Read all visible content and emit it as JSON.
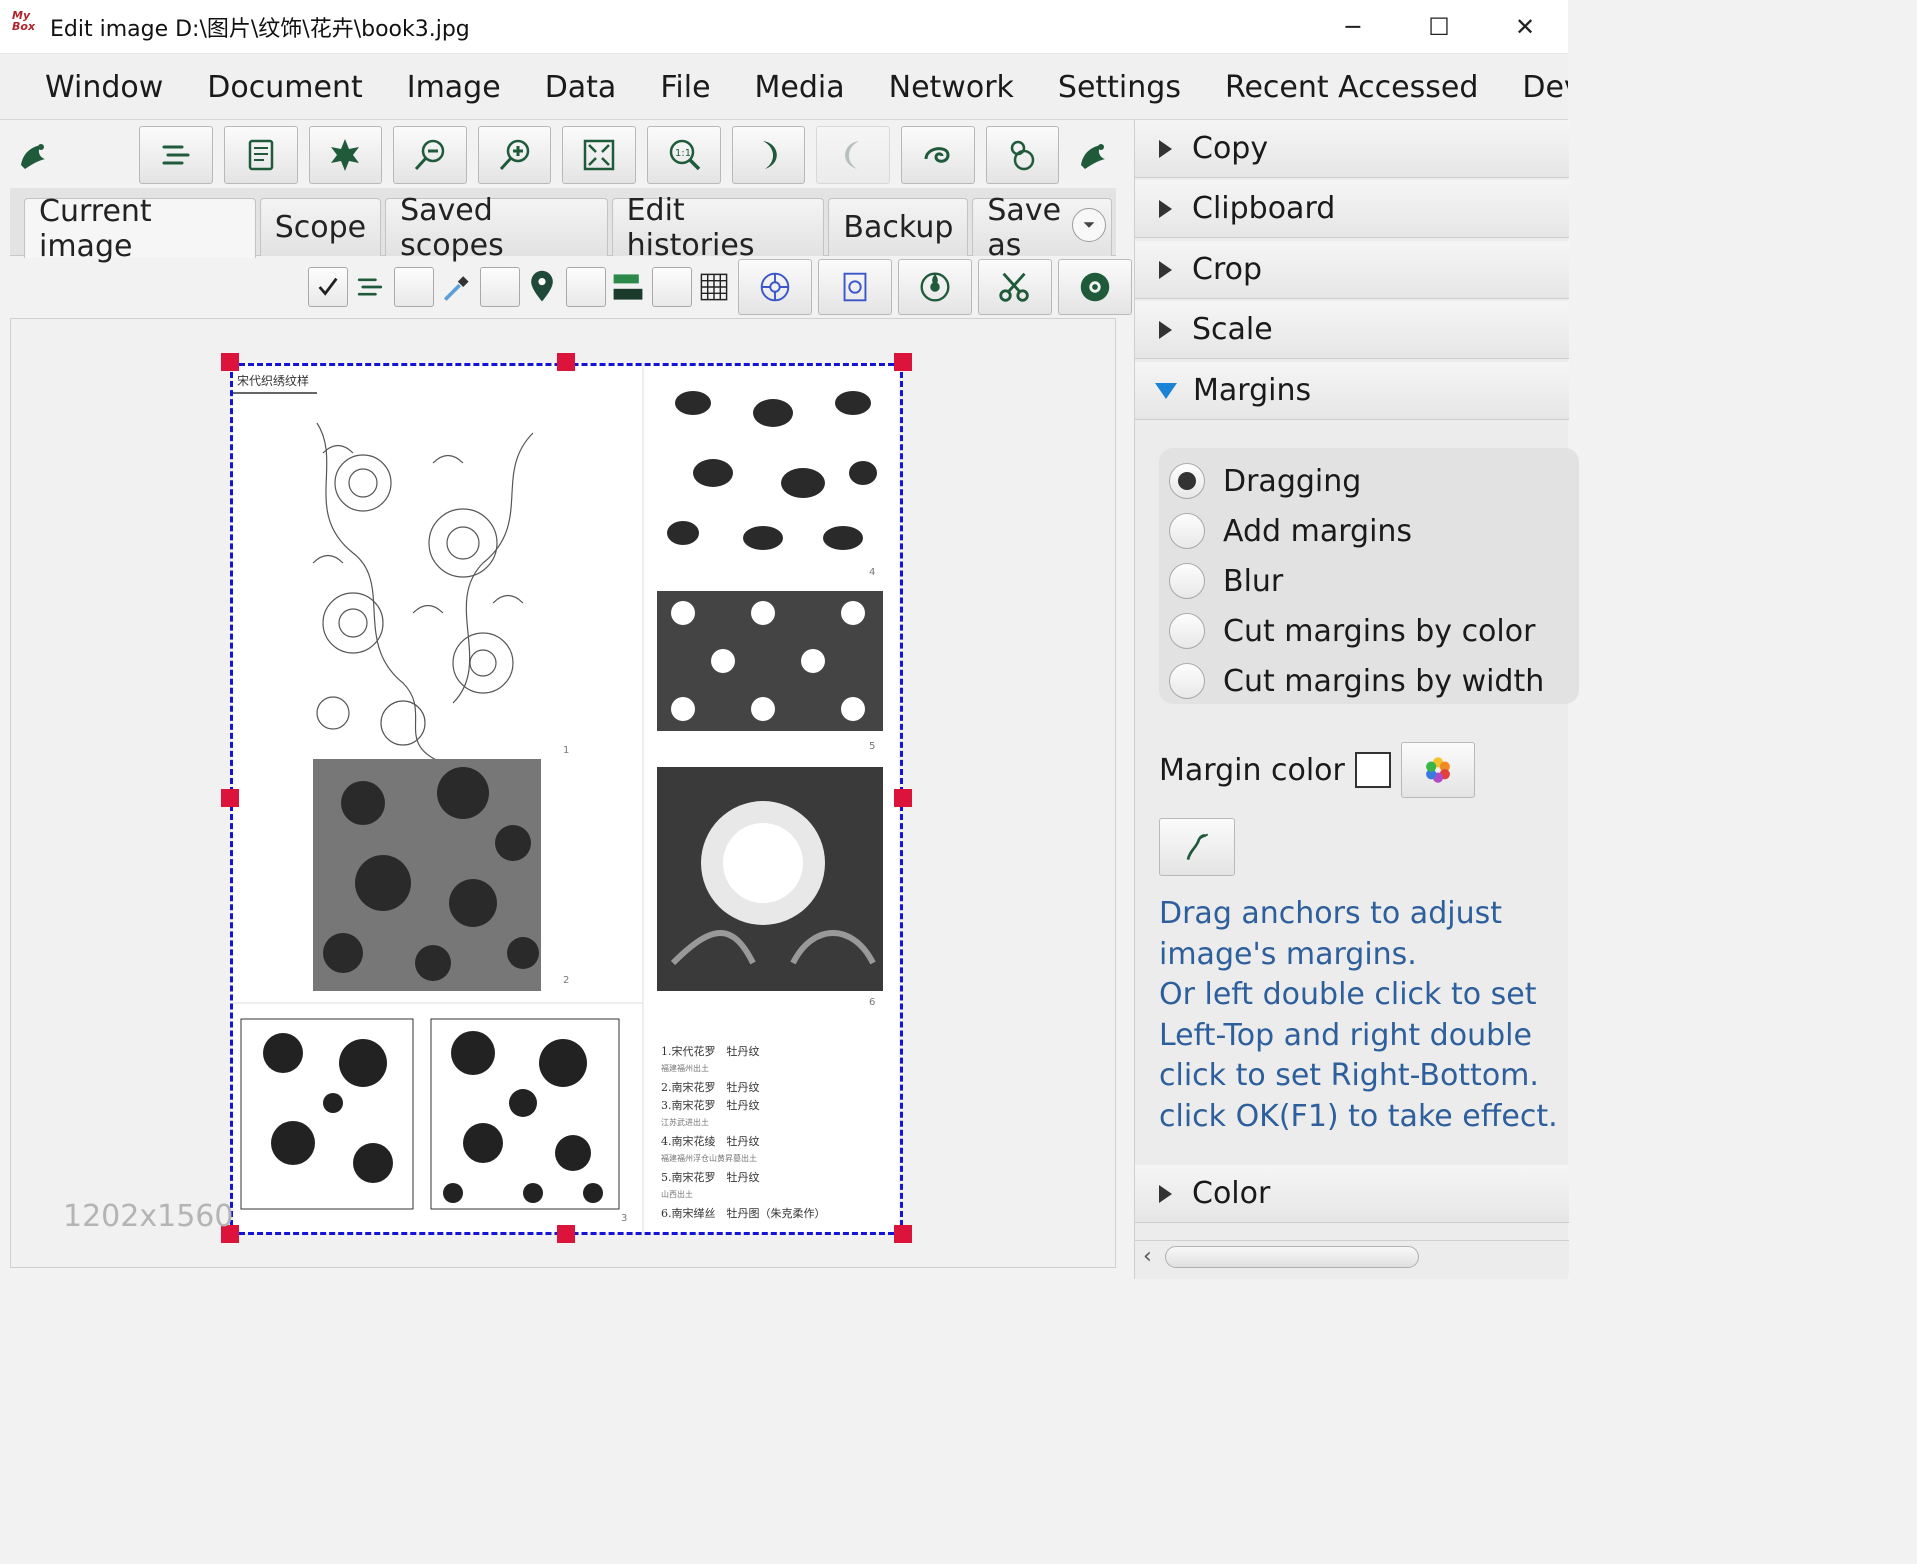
{
  "window": {
    "logo_text": "MyBox",
    "title": "Edit image D:\\图片\\纹饰\\花卉\\book3.jpg",
    "minimize": "─",
    "maximize": "☐",
    "close": "✕"
  },
  "menubar": {
    "items": [
      "Window",
      "Document",
      "Image",
      "Data",
      "File",
      "Media",
      "Network",
      "Settings",
      "Recent Accessed",
      "Develo"
    ]
  },
  "tabs": {
    "items": [
      "Current image",
      "Scope",
      "Saved scopes",
      "Edit histories",
      "Backup",
      "Save as"
    ]
  },
  "canvas": {
    "dimensions": "1202x1560",
    "page_header_text": "宋代织绣纹样",
    "caption_lines": [
      "1.宋代花罗　牡丹纹",
      "福建福州出土",
      "2.南宋花罗　牡丹纹",
      "3.南宋花罗　牡丹纹",
      "江苏武进出土",
      "4.南宋花绫　牡丹纹",
      "福建福州浮仓山黄昇墓出土",
      "5.南宋花罗　牡丹纹",
      "山西出土",
      "6.南宋缂丝　牡丹图（朱克柔作）"
    ],
    "figure_numbers": [
      "1",
      "2",
      "3",
      "4",
      "5",
      "6"
    ]
  },
  "panel": {
    "sections": {
      "copy": "Copy",
      "clipboard": "Clipboard",
      "crop": "Crop",
      "scale": "Scale",
      "margins": "Margins",
      "color": "Color"
    },
    "radio_options": [
      "Dragging",
      "Add margins",
      "Blur",
      "Cut margins by color",
      "Cut margins by width"
    ],
    "selected_option": "Dragging",
    "margin_color_label": "Margin color",
    "margin_color_value": "#ffffff",
    "tips": [
      "Drag anchors to adjust",
      "image's margins.",
      "Or left double click to set",
      "Left-Top and right double",
      "click to set Right-Bottom.",
      "click OK(F1) to take effect."
    ]
  },
  "icons": {
    "toolbar": [
      "align-icon",
      "memo-icon",
      "maple-leaf-icon",
      "zoom-out-icon",
      "zoom-in-icon",
      "fit-window-icon",
      "actual-size-icon",
      "rotate-right-icon",
      "rotate-left-icon",
      "swirl-icon",
      "gourd-icon"
    ],
    "scope_toolbar": [
      "align-icon",
      "color-picker-icon",
      "location-pin-icon",
      "fill-icon",
      "grid-icon",
      "lotus-scope-icon",
      "tile-scope-icon",
      "flower-scope-icon",
      "scissors-icon",
      "sunflower-icon"
    ]
  },
  "colors": {
    "accent_text": "#2d5f9c",
    "selection_border": "#1414d8",
    "anchor": "#dc143c",
    "icon_green": "#1f5b3a"
  }
}
